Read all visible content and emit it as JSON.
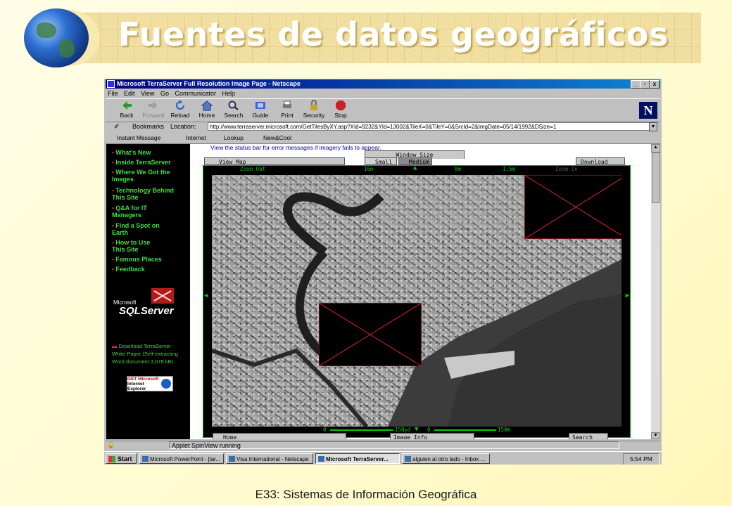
{
  "slide": {
    "title": "Fuentes de datos geográficos",
    "footer": "E33: Sistemas de Información Geográfica"
  },
  "window": {
    "title": "Microsoft TerraServer Full Resolution Image Page - Netscape",
    "controls": [
      "_",
      "▫",
      "x"
    ]
  },
  "menu": [
    "File",
    "Edit",
    "View",
    "Go",
    "Communicator",
    "Help"
  ],
  "toolbar": [
    {
      "label": "Back",
      "icon": "back-arrow-icon"
    },
    {
      "label": "Forward",
      "icon": "forward-arrow-icon"
    },
    {
      "label": "Reload",
      "icon": "reload-icon"
    },
    {
      "label": "Home",
      "icon": "home-icon"
    },
    {
      "label": "Search",
      "icon": "search-icon"
    },
    {
      "label": "Guide",
      "icon": "guide-icon"
    },
    {
      "label": "Print",
      "icon": "print-icon"
    },
    {
      "label": "Security",
      "icon": "lock-icon"
    },
    {
      "label": "Stop",
      "icon": "stop-icon"
    }
  ],
  "location": {
    "bookmarks_label": "Bookmarks",
    "location_label": "Location:",
    "url": "http://www.terraserver.microsoft.com/GetTilesByXY.asp?XId=9232&YId=13002&TileX=0&TileY=0&SrcId=2&ImgDate=05/14/1992&DSize=1"
  },
  "personal_bar": [
    "Instant Message",
    "Internet",
    "Lookup",
    "New&Cool"
  ],
  "nav": [
    "What's New",
    "Inside TerraServer",
    "Where We Got the Images",
    "Technology Behind This Site",
    "Q&A for IT Managers",
    "Find a Spot on Earth",
    "How to Use This Site",
    "Famous Places",
    "Feedback"
  ],
  "sql_logo": {
    "top": "Microsoft",
    "main": "SQLServer"
  },
  "download": "Download TerraServer White Paper (Self-extracting Word document 3,078 kB)",
  "ie_badge": {
    "line1": "GET Microsoft",
    "line2": "Internet",
    "line3": "Explorer"
  },
  "viewer": {
    "status_msg": "View the status bar for error messages if imagery fails to appear.",
    "window_size": "Window Size",
    "view_map": "View Map",
    "small": "Small",
    "medium": "Medium",
    "download": "Download",
    "zoom_out": "Zoom Out",
    "zoom_in": "Zoom In",
    "res_labels": [
      "16m",
      "8m",
      "1.5m"
    ],
    "scale_left": [
      "0",
      "150yd"
    ],
    "scale_right": [
      "0",
      "150m"
    ],
    "home": "Home",
    "image_info": "Image Info",
    "search": "Search"
  },
  "status_text": "Applet SpinView running",
  "taskbar": {
    "start": "Start",
    "items": [
      "Microsoft PowerPoint - [lar...",
      "Visa International - Netscape",
      "Microsoft TerraServer...",
      "alguien al otro lado - Inbox ..."
    ],
    "clock": "5:54 PM"
  },
  "colors": {
    "nav_text": "#44dd44",
    "title_bar": "#000080",
    "frame_green": "#00aa00"
  }
}
